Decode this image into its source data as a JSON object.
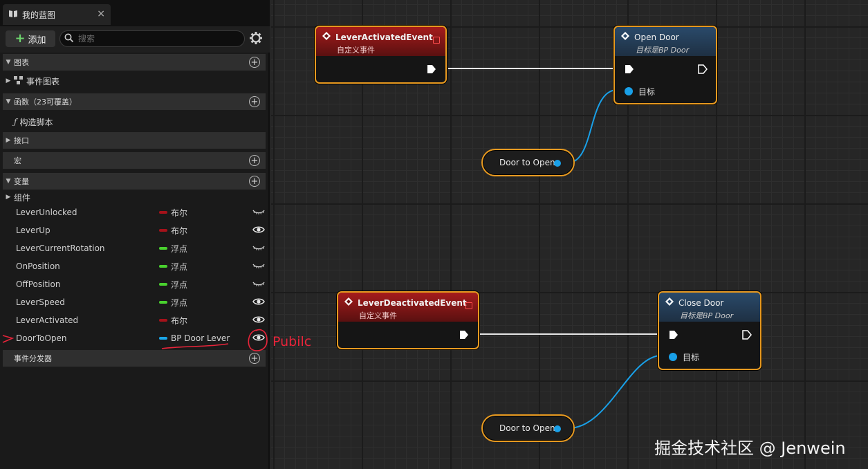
{
  "tab": {
    "title": "我的蓝图",
    "close": "×"
  },
  "toolbar": {
    "add_label": "添加",
    "search_placeholder": "搜索"
  },
  "sections": {
    "graphs": "图表",
    "event_graph": "事件图表",
    "functions": "函数（23可覆盖）",
    "construction_script": "构造脚本",
    "interfaces": "接口",
    "macros": "宏",
    "variables": "变量",
    "components": "组件",
    "dispatchers": "事件分发器"
  },
  "variables": [
    {
      "name": "LeverUnlocked",
      "type": "布尔",
      "color": "#a5121a",
      "public": false
    },
    {
      "name": "LeverUp",
      "type": "布尔",
      "color": "#a5121a",
      "public": true
    },
    {
      "name": "LeverCurrentRotation",
      "type": "浮点",
      "color": "#49d12e",
      "public": false
    },
    {
      "name": "OnPosition",
      "type": "浮点",
      "color": "#49d12e",
      "public": false
    },
    {
      "name": "OffPosition",
      "type": "浮点",
      "color": "#49d12e",
      "public": false
    },
    {
      "name": "LeverSpeed",
      "type": "浮点",
      "color": "#49d12e",
      "public": true
    },
    {
      "name": "LeverActivated",
      "type": "布尔",
      "color": "#a5121a",
      "public": true
    },
    {
      "name": "DoorToOpen",
      "type": "BP Door Lever",
      "color": "#1aa6e8",
      "public": true
    }
  ],
  "annotation": {
    "text": "Pubilc",
    "color": "#e8243a"
  },
  "nodes": {
    "lever_activated": {
      "title": "LeverActivatedEvent",
      "subtitle": "自定义事件"
    },
    "open_door": {
      "title": "Open Door",
      "subtitle": "目标是BP Door",
      "target_label": "目标"
    },
    "var_top": {
      "label": "Door to Open"
    },
    "lever_deactivated": {
      "title": "LeverDeactivatedEvent",
      "subtitle": "自定义事件"
    },
    "close_door": {
      "title": "Close Door",
      "subtitle": "目标是BP Door",
      "target_label": "目标"
    },
    "var_bottom": {
      "label": "Door to Open"
    }
  },
  "watermark": "掘金技术社区 @ Jenwein",
  "colors": {
    "accent": "#e89a20",
    "object_pin": "#19a0e8",
    "event_header": "#a51c1c",
    "func_header": "#2a4a6a"
  }
}
